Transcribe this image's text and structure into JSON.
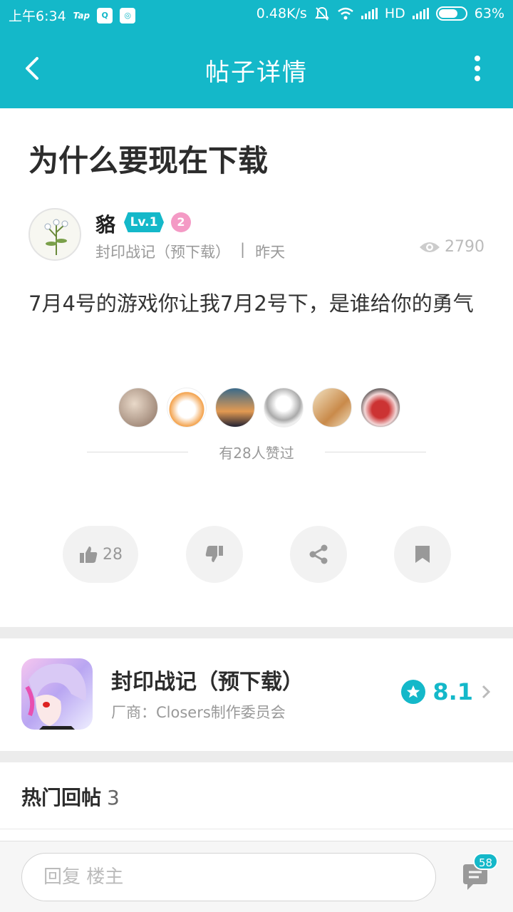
{
  "status_bar": {
    "time": "上午6:34",
    "tap_label": "Tap",
    "network_speed": "0.48K/s",
    "hd_label": "HD",
    "battery": "63%"
  },
  "header": {
    "title": "帖子详情"
  },
  "post": {
    "title": "为什么要现在下载",
    "author": {
      "name": "貉",
      "level": "Lv.1",
      "medal_number": "2"
    },
    "forum": "封印战记（预下载）",
    "separator": "|",
    "time": "昨天",
    "views": "2790",
    "body": "7月4号的游戏你让我7月2号下，是谁给你的勇气",
    "liked_text": "有28人赞过"
  },
  "actions": {
    "like_count": "28"
  },
  "game": {
    "name": "封印战记（预下载）",
    "developer": "厂商：Closers制作委员会",
    "rating": "8.1"
  },
  "replies": {
    "title": "热门回帖",
    "count": "3"
  },
  "bottom_bar": {
    "placeholder": "回复 楼主",
    "comment_count": "58"
  },
  "colors": {
    "accent": "#14b8c9",
    "medal_pink": "#f49ac5",
    "separator_gray": "#ececec"
  }
}
